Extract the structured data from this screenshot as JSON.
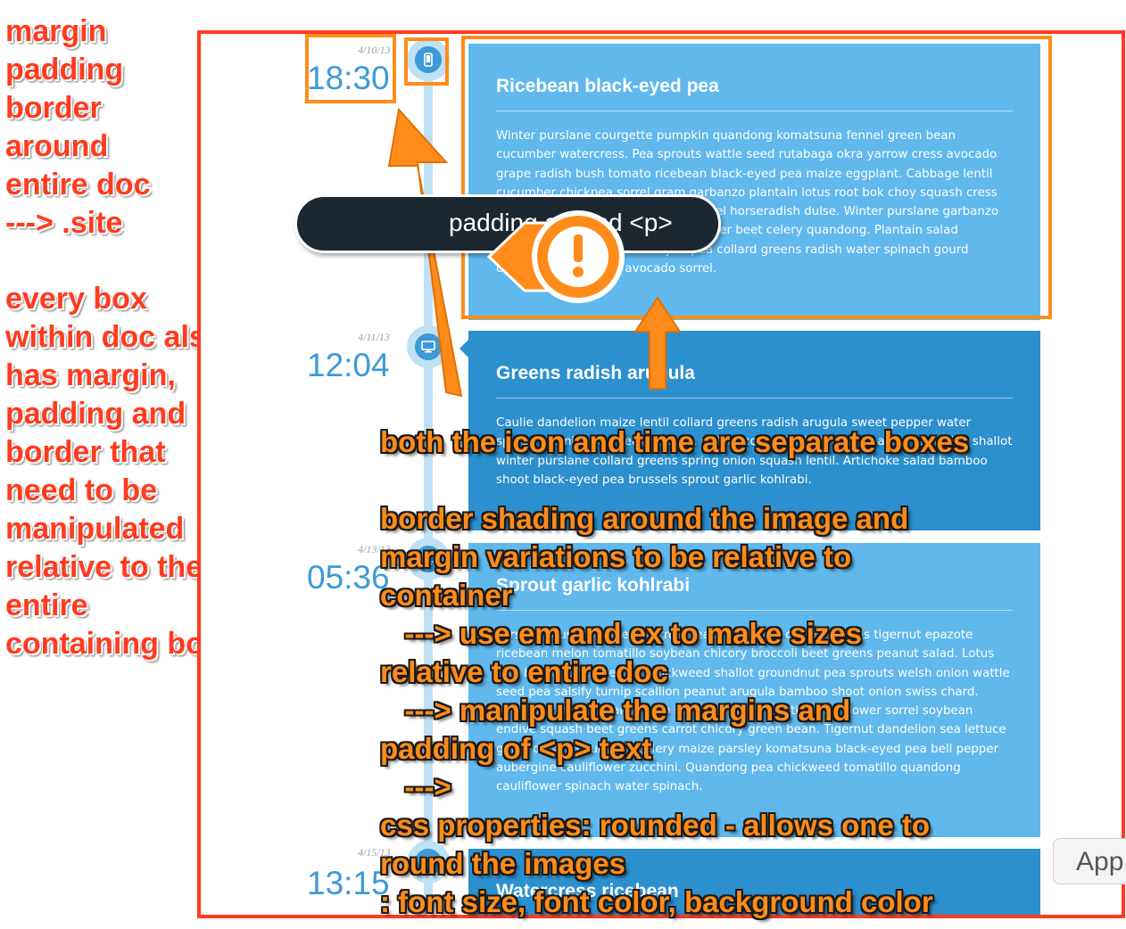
{
  "left_annotation": {
    "top_lines": [
      "margin",
      "padding",
      "border",
      "around",
      "entire doc",
      "---> .site"
    ],
    "bottom_lines": [
      "every box",
      "within doc also",
      "has margin,",
      "padding and",
      "border that",
      "need to be",
      "manipulated",
      "relative to the",
      "entire",
      "containing box"
    ]
  },
  "timeline": [
    {
      "date": "4/10/13",
      "time": "18:30",
      "icon": "phone-icon",
      "title": "Ricebean black-eyed pea",
      "body": "Winter purslane courgette pumpkin quandong komatsuna fennel green bean cucumber watercress. Pea sprouts wattle seed rutabaga okra yarrow cress avocado grape radish bush tomato ricebean black-eyed pea maize eggplant. Cabbage lentil cucumber chickpea sorrel gram garbanzo plantain lotus root bok choy squash cress potato summer purslane salsify fennel horseradish dulse. Winter purslane garbanzo artichoke broccoli lentil corn okra silver beet celery quandong. Plantain salad beetroot bunya nuts black-eyed pea collard greens radish water spinach gourd chicory prairie turnip avocado sorrel."
    },
    {
      "date": "4/11/13",
      "time": "12:04",
      "icon": "monitor-icon",
      "title": "Greens radish arugula",
      "body": "Caulie dandelion maize lentil collard greens radish arugula sweet pepper water spinach kombu courgette lettuce. Celery coriander bitterleaf epazote radicchio shallot winter purslane collard greens spring onion squash lentil. Artichoke salad bamboo shoot black-eyed pea brussels sprout garlic kohlrabi."
    },
    {
      "date": "4/13/13",
      "time": "05:36",
      "icon": "monitor-icon",
      "title": "Sprout garlic kohlrabi",
      "body": "Parsnip lotus root celery yarrow seakale tomato collard greens tigernut epazote ricebean melon tomatillo soybean chicory broccoli beet greens peanut salad. Lotus root burdock bell pepper chickweed shallot groundnut pea sprouts welsh onion wattle seed pea salsify turnip scallion peanut arugula bamboo shoot onion swiss chard. Avocado tomato peanut soko sweet pepper tomatillo cauliflower sorrel soybean endive squash beet greens carrot chicory green bean. Tigernut dandelion sea lettuce garlic daikon courgette celery maize parsley komatsuna black-eyed pea bell pepper aubergine cauliflower zucchini. Quandong pea chickweed tomatillo quandong cauliflower spinach water spinach."
    },
    {
      "date": "4/15/13",
      "time": "13:15",
      "icon": "monitor-icon",
      "title": "Watercress ricebean",
      "body": ""
    }
  ],
  "tooltip": {
    "text": "padding around <p>",
    "icon": "exclamation-icon"
  },
  "app_button": "App",
  "orange_annotation": {
    "line1": "both the icon and time are separate boxes",
    "block2": [
      "border shading around the image and",
      "margin variations to be relative to",
      "container",
      "   ---> use em and ex to make sizes",
      "relative to entire doc",
      "   ---> manipulate the margins and",
      "padding of <p> text",
      "   --->",
      "css properties: rounded - allows one to",
      "round the images",
      ": font size, font color, background color"
    ]
  },
  "colors": {
    "annotation_red": "#ff3b1f",
    "annotation_orange": "#ff8c1a",
    "card_light": "#60b8ed",
    "card_dark": "#2c8fce",
    "time_blue": "#3c9ad6"
  }
}
